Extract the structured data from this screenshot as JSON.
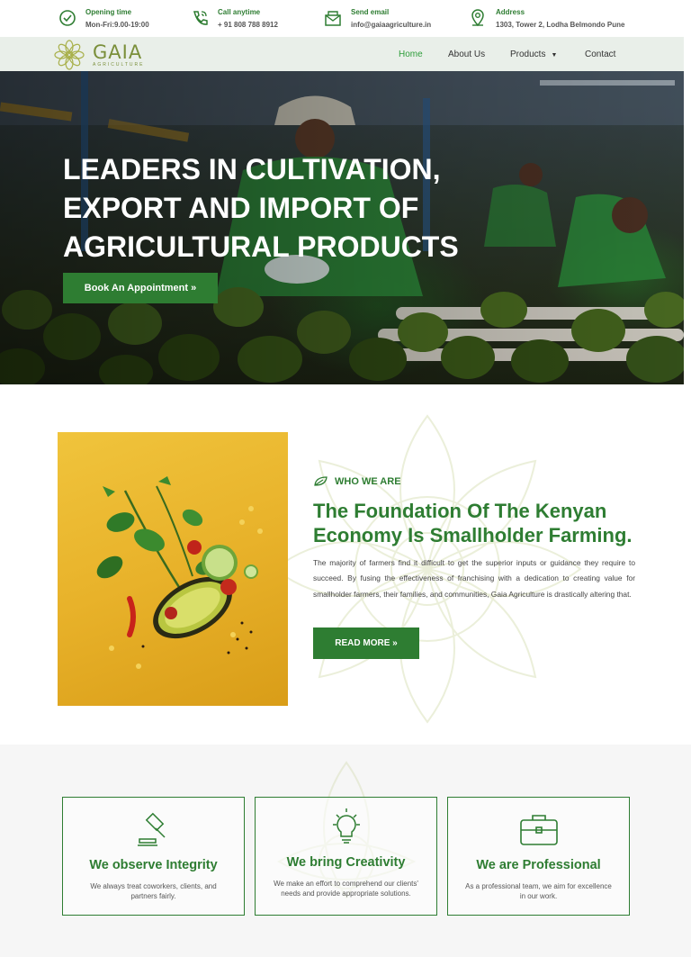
{
  "topbar": {
    "items": [
      {
        "title": "Opening time",
        "value": "Mon-Fri:9.00-19:00",
        "icon": "clock-icon"
      },
      {
        "title": "Call anytime",
        "value": "+ 91 808 788 8912",
        "icon": "phone-icon"
      },
      {
        "title": "Send email",
        "value": "info@gaiaagriculture.in",
        "icon": "mail-icon"
      },
      {
        "title": "Address",
        "value": "1303, Tower 2, Lodha Belmondo Pune",
        "icon": "location-pin-icon"
      }
    ]
  },
  "nav": {
    "logo_name": "GAIA",
    "logo_sub": "AGRICULTURE",
    "items": [
      {
        "label": "Home",
        "active": true
      },
      {
        "label": "About Us"
      },
      {
        "label": "Products",
        "has_dropdown": true
      },
      {
        "label": "Contact"
      }
    ]
  },
  "hero": {
    "heading": "LEADERS IN CULTIVATION, EXPORT AND IMPORT OF AGRICULTURAL PRODUCTS",
    "button": "Book An Appointment »"
  },
  "about": {
    "eyebrow": "WHO WE ARE",
    "heading": "The Foundation Of The Kenyan Economy Is Smallholder Farming.",
    "body": "The majority of farmers find it difficult to get the superior inputs or guidance they require to succeed. By fusing the effectiveness of franchising with a dedication to creating value for smallholder farmers, their families, and communities, Gaia Agriculture is drastically altering that.",
    "button": "READ MORE »"
  },
  "values": [
    {
      "title": "We observe Integrity",
      "desc": "We always treat coworkers, clients, and partners fairly.",
      "icon": "gavel-icon"
    },
    {
      "title": "We bring Creativity",
      "desc": "We make an effort to comprehend our clients' needs and provide appropriate solutions.",
      "icon": "lightbulb-icon"
    },
    {
      "title": "We are Professional",
      "desc": "As a professional team, we aim for excellence in our work.",
      "icon": "briefcase-icon"
    }
  ],
  "colors": {
    "brand_green": "#2e7d32",
    "logo_olive": "#7a8f3a",
    "nav_bg": "#e9efe9"
  }
}
